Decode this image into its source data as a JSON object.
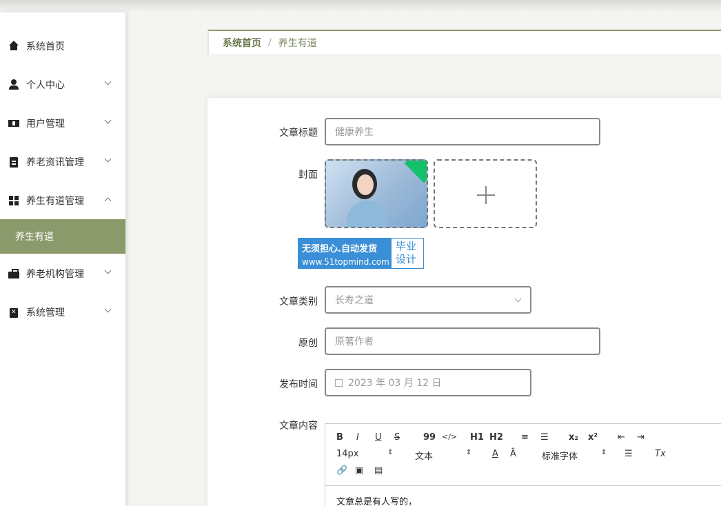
{
  "sidebar": {
    "items": [
      {
        "label": "系统首页",
        "icon": "home-icon"
      },
      {
        "label": "个人中心",
        "icon": "user-icon"
      },
      {
        "label": "用户管理",
        "icon": "users-icon"
      },
      {
        "label": "养老资讯管理",
        "icon": "document-icon"
      },
      {
        "label": "养生有道管理",
        "icon": "grid-icon"
      },
      {
        "label": "养老机构管理",
        "icon": "briefcase-icon"
      },
      {
        "label": "系统管理",
        "icon": "clipboard-icon"
      }
    ],
    "active_sub": "养生有道"
  },
  "breadcrumb": {
    "home": "系统首页",
    "separator": "/",
    "current": "养生有道"
  },
  "form": {
    "title_label": "文章标题",
    "title_value": "健康养生",
    "cover_label": "封面",
    "category_label": "文章类别",
    "category_value": "长寿之道",
    "original_label": "原创",
    "original_value": "原著作者",
    "publish_label": "发布时间",
    "publish_value": "2023 年 03 月 12 日",
    "content_label": "文章内容",
    "content_text": "文章总是有人写的，"
  },
  "promo": {
    "line1": "无须担心.自动发货",
    "line2": "www.51topmind.com",
    "badge1": "毕业",
    "badge2": "设计"
  },
  "editor": {
    "font_size": "14px",
    "text_style": "文本",
    "font_family": "标准字体",
    "buttons": [
      "B",
      "I",
      "U",
      "S",
      "99",
      "</>",
      "H1",
      "H2",
      "x₂",
      "x²",
      "Tx"
    ]
  },
  "colors": {
    "accent": "#8a9a6a",
    "success": "#13c16a"
  }
}
